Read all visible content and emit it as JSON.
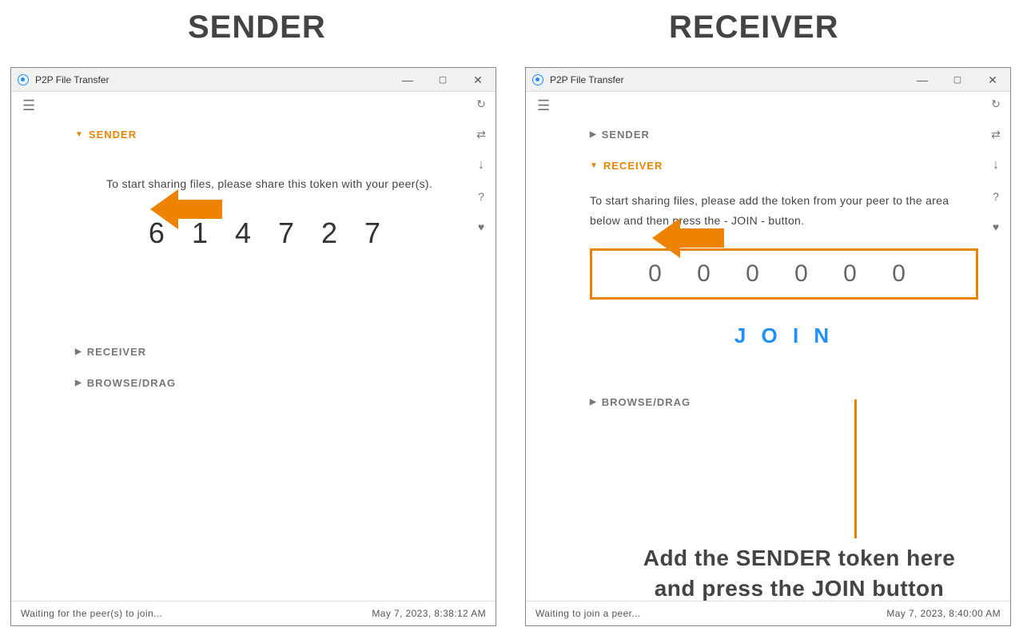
{
  "headings": {
    "sender": "SENDER",
    "receiver": "RECEIVER"
  },
  "app_title": "P2P File Transfer",
  "window_controls": {
    "minimize": "—",
    "maximize": "▢",
    "close": "✕"
  },
  "toolbar_icons": {
    "refresh": "↻",
    "swap": "⇄",
    "download": "↓",
    "help": "?",
    "heart": "♥"
  },
  "sender_win": {
    "sections": {
      "sender": {
        "label": "SENDER",
        "expanded": true
      },
      "receiver": {
        "label": "RECEIVER",
        "expanded": false
      },
      "browse": {
        "label": "BROWSE/DRAG",
        "expanded": false
      }
    },
    "instruction": "To start sharing files, please share this token with your peer(s).",
    "token": "6 1 4 7 2 7",
    "status_left": "Waiting for the peer(s) to join...",
    "status_right": "May 7, 2023, 8:38:12 AM"
  },
  "receiver_win": {
    "sections": {
      "sender": {
        "label": "SENDER",
        "expanded": false
      },
      "receiver": {
        "label": "RECEIVER",
        "expanded": true
      },
      "browse": {
        "label": "BROWSE/DRAG",
        "expanded": false
      }
    },
    "instruction": "To start sharing files, please add the token from your peer to the area below and then press the - JOIN - button.",
    "token_placeholder": "0 0 0 0 0 0",
    "join_label": "J O I N",
    "status_left": "Waiting to join a peer...",
    "status_right": "May 7, 2023, 8:40:00 AM"
  },
  "callout": "Add the SENDER token here\nand press the JOIN button"
}
